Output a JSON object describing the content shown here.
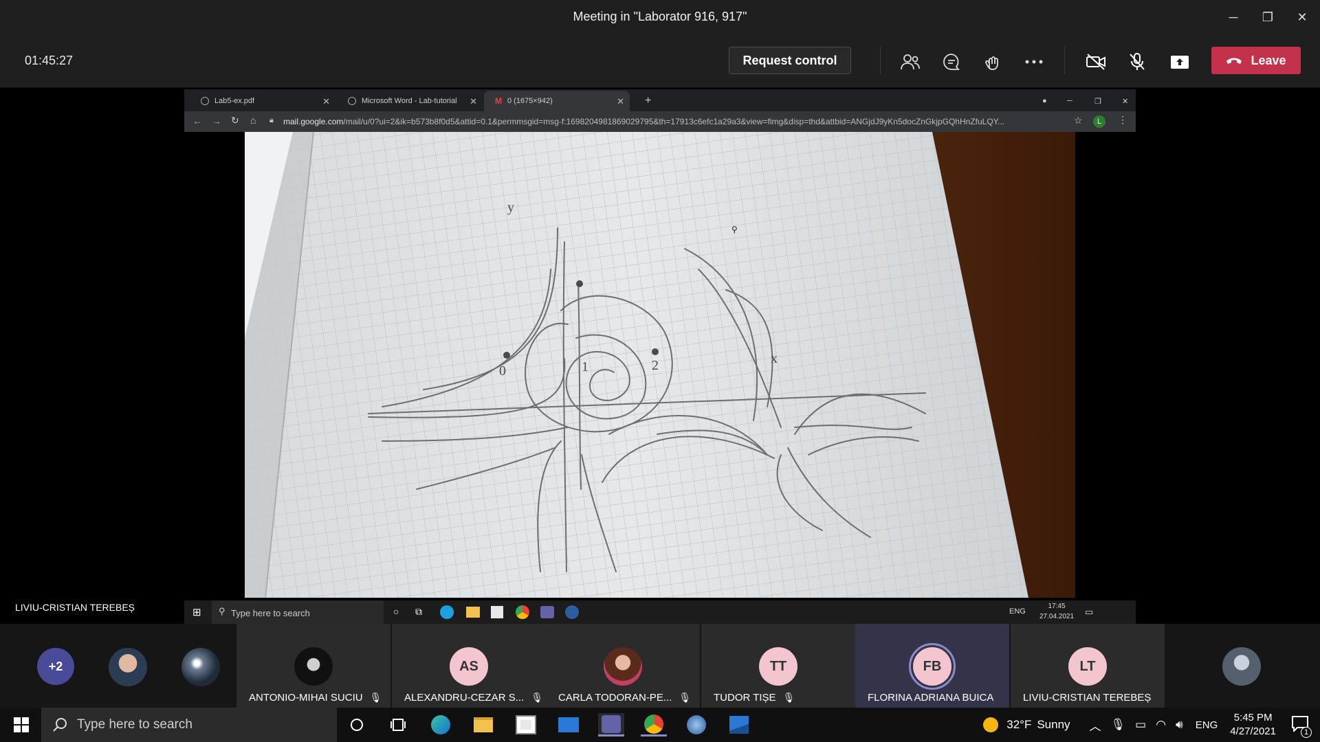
{
  "window": {
    "title": "Meeting in \"Laborator 916, 917\""
  },
  "toolbar": {
    "timer": "01:45:27",
    "request_control": "Request control",
    "leave": "Leave"
  },
  "browser": {
    "tabs": [
      {
        "label": "Lab5-ex.pdf"
      },
      {
        "label": "Microsoft Word - Lab-tutorial"
      },
      {
        "label": "0 (1675×942)"
      }
    ],
    "url_host": "mail.google.com",
    "url_path": "/mail/u/0?ui=2&ik=b573b8f0d5&attid=0.1&permmsgid=msg-f:1698204981869029795&th=17913c6efc1a29a3&view=fimg&disp=thd&attbid=ANGjdJ9yKn5docZnGkjpGQhHnZfuLQY...",
    "profile_initial": "L"
  },
  "shared_screen": {
    "sharer_name": "LIVIU-CRISTIAN TEREBEȘ",
    "search_placeholder": "Type here to search",
    "lang": "ENG",
    "time": "17:45",
    "date": "27.04.2021"
  },
  "sketch_labels": {
    "zero": "0",
    "one": "1",
    "two": "2",
    "xlab": "x",
    "ylab": "y"
  },
  "participants": [
    {
      "kind": "overflow",
      "label": "+2"
    },
    {
      "kind": "photo",
      "name": ""
    },
    {
      "kind": "photo",
      "name": ""
    },
    {
      "kind": "tile",
      "name": "ANTONIO-MIHAI SUCIU",
      "initials": "",
      "color": "#1e1e1e",
      "muted": true
    },
    {
      "kind": "tile",
      "name": "ALEXANDRU-CEZAR S...",
      "initials": "AS",
      "color": "#f2c5cf",
      "muted": true
    },
    {
      "kind": "tile",
      "name": "CARLA TODORAN-PE...",
      "initials": "",
      "color": "#3a2a2a",
      "muted": true
    },
    {
      "kind": "tile",
      "name": "TUDOR TIȘE",
      "initials": "TT",
      "color": "#f2c5cf",
      "muted": true
    },
    {
      "kind": "tile",
      "name": "FLORINA ADRIANA BUICA",
      "initials": "FB",
      "color": "#f2c5cf",
      "muted": false,
      "speaking": true
    },
    {
      "kind": "tile",
      "name": "LIVIU-CRISTIAN TEREBEȘ",
      "initials": "LT",
      "color": "#f2c5cf",
      "muted": false
    },
    {
      "kind": "tile",
      "name": "",
      "initials": "",
      "color": "#445",
      "muted": false
    }
  ],
  "taskbar": {
    "search_placeholder": "Type here to search",
    "weather_temp": "32°F",
    "weather_text": "Sunny",
    "lang": "ENG",
    "time": "5:45 PM",
    "date": "4/27/2021",
    "notif_count": "1"
  }
}
